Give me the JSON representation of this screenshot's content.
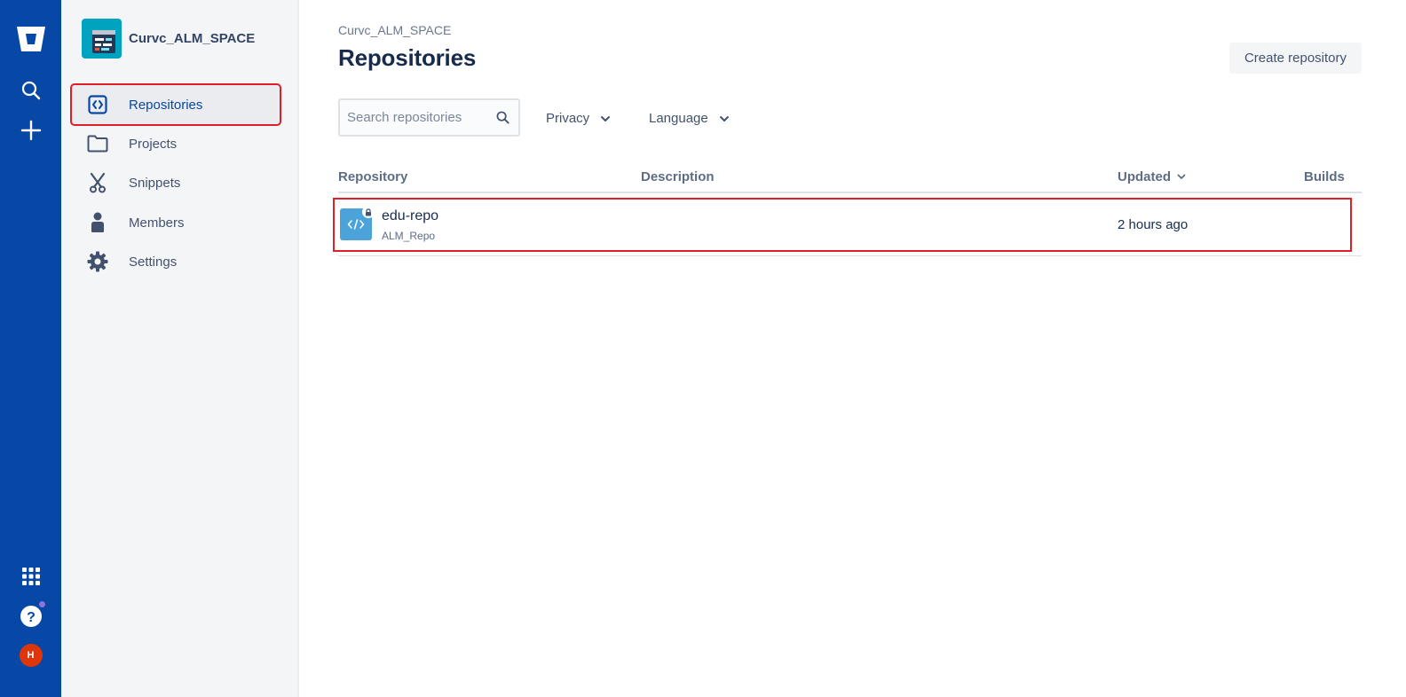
{
  "rail": {
    "items": [
      {
        "name": "bitbucket-logo-icon"
      },
      {
        "name": "search-icon"
      },
      {
        "name": "create-icon"
      },
      {
        "name": "apps-grid-icon"
      },
      {
        "name": "help-icon"
      }
    ],
    "avatar_initial": "H",
    "bg_color": "#0747a6"
  },
  "sidebar": {
    "workspace_name": "Curvc_ALM_SPACE",
    "items": [
      {
        "label": "Repositories",
        "icon": "code-brackets-icon",
        "active": true
      },
      {
        "label": "Projects",
        "icon": "folder-icon"
      },
      {
        "label": "Snippets",
        "icon": "scissors-icon"
      },
      {
        "label": "Members",
        "icon": "person-icon"
      },
      {
        "label": "Settings",
        "icon": "gear-icon"
      }
    ]
  },
  "main": {
    "breadcrumb": "Curvc_ALM_SPACE",
    "title": "Repositories",
    "create_button": "Create repository",
    "search": {
      "placeholder": "Search repositories",
      "value": ""
    },
    "filters": {
      "privacy": "Privacy",
      "language": "Language"
    },
    "table": {
      "columns": {
        "repository": "Repository",
        "description": "Description",
        "updated": "Updated",
        "builds": "Builds"
      },
      "rows": [
        {
          "name": "edu-repo",
          "project": "ALM_Repo",
          "description": "",
          "updated": "2 hours ago",
          "builds": "",
          "private": true
        }
      ]
    }
  },
  "colors": {
    "accent": "#0052cc",
    "highlight_outline": "#e01e26",
    "repo_icon": "#4ca3d9"
  }
}
